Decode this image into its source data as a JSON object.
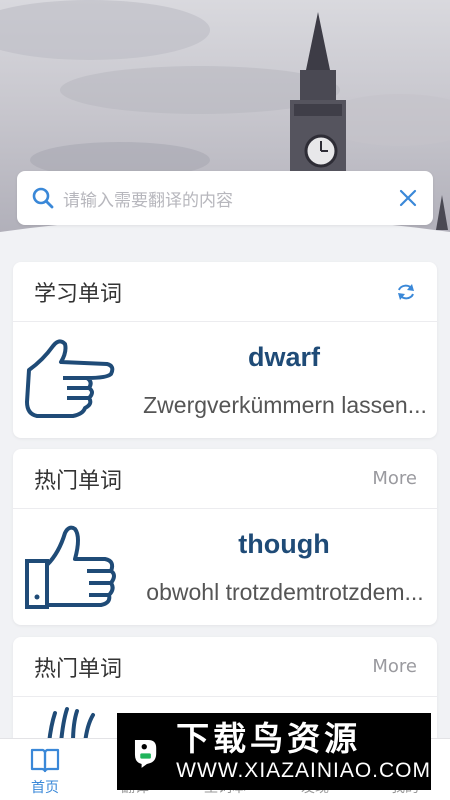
{
  "search": {
    "placeholder": "请输入需要翻译的内容"
  },
  "cards": [
    {
      "title": "学习单词",
      "word": "dwarf",
      "meaning": "Zwergverkümmern lassen..."
    },
    {
      "title": "热门单词",
      "more": "More",
      "word": "though",
      "meaning": "obwohl trotzdemtrotzdem..."
    },
    {
      "title": "热门单词",
      "more": "More"
    }
  ],
  "tabs": [
    {
      "label": "首页",
      "icon": "book-icon"
    },
    {
      "label": "翻译",
      "icon": "translate-icon"
    },
    {
      "label": "生词本",
      "icon": "notebook-icon"
    },
    {
      "label": "发现",
      "icon": "discover-icon"
    },
    {
      "label": "我的",
      "icon": "profile-icon"
    }
  ],
  "watermark": {
    "title": "下载鸟资源",
    "url": "WWW.XIAZAINIAO.COM"
  },
  "colors": {
    "accent": "#3a88d8",
    "word": "#1f4b77",
    "icon_line": "#1f4b77"
  }
}
